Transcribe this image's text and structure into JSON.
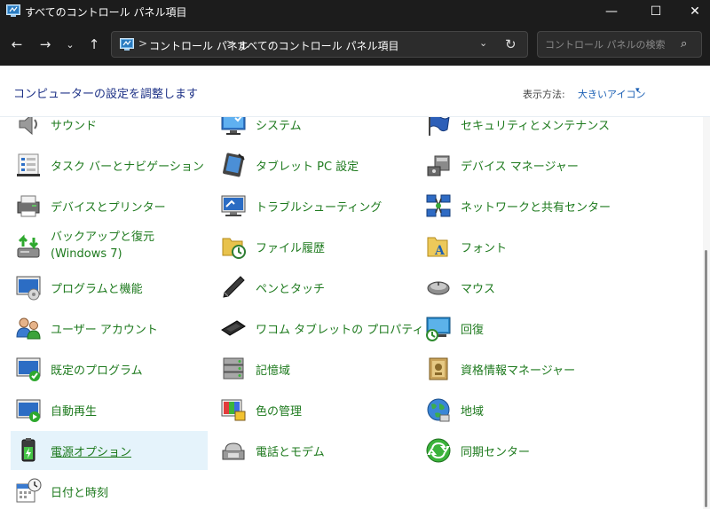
{
  "window": {
    "title": "すべてのコントロール パネル項目",
    "minimize_glyph": "—",
    "maximize_glyph": "☐",
    "close_glyph": "✕"
  },
  "nav": {
    "back_glyph": "←",
    "forward_glyph": "→",
    "recent_glyph": "⌄",
    "up_glyph": "↑",
    "breadcrumb": [
      "コントロール パネル",
      "すべてのコントロール パネル項目"
    ],
    "breadcrumb_separator": ">",
    "dropdown_glyph": "⌄",
    "refresh_glyph": "↻"
  },
  "search": {
    "placeholder": "コントロール パネルの検索",
    "value": "",
    "icon_glyph": "⌕"
  },
  "header": {
    "title": "コンピューターの設定を調整します",
    "view_label": "表示方法:",
    "view_value": "大きいアイコン",
    "view_caret": "▾"
  },
  "colors": {
    "titlebar_bg": "#1c1c1c",
    "item_label": "#1e7a1e",
    "header_title": "#1e3287",
    "link_accent": "#1a5fb4",
    "hover_bg": "#e5f3fb"
  },
  "items": [
    {
      "label": "サウンド",
      "icon": "speaker-icon"
    },
    {
      "label": "システム",
      "icon": "system-monitor-icon"
    },
    {
      "label": "セキュリティとメンテナンス",
      "icon": "security-flag-icon"
    },
    {
      "label": "タスク バーとナビゲーション",
      "icon": "taskbar-icon"
    },
    {
      "label": "タブレット PC 設定",
      "icon": "tablet-pc-icon"
    },
    {
      "label": "デバイス マネージャー",
      "icon": "device-manager-icon"
    },
    {
      "label": "デバイスとプリンター",
      "icon": "printer-icon"
    },
    {
      "label": "トラブルシューティング",
      "icon": "troubleshooting-icon"
    },
    {
      "label": "ネットワークと共有センター",
      "icon": "network-icon"
    },
    {
      "label": "バックアップと復元 (Windows 7)",
      "icon": "backup-restore-icon"
    },
    {
      "label": "ファイル履歴",
      "icon": "file-history-icon"
    },
    {
      "label": "フォント",
      "icon": "font-folder-icon"
    },
    {
      "label": "プログラムと機能",
      "icon": "programs-features-icon"
    },
    {
      "label": "ペンとタッチ",
      "icon": "pen-icon"
    },
    {
      "label": "マウス",
      "icon": "mouse-icon"
    },
    {
      "label": "ユーザー アカウント",
      "icon": "user-accounts-icon"
    },
    {
      "label": "ワコム タブレットの プロパティ",
      "icon": "wacom-tablet-icon"
    },
    {
      "label": "回復",
      "icon": "recovery-icon"
    },
    {
      "label": "既定のプログラム",
      "icon": "default-programs-icon"
    },
    {
      "label": "記憶域",
      "icon": "storage-spaces-icon"
    },
    {
      "label": "資格情報マネージャー",
      "icon": "credential-manager-icon"
    },
    {
      "label": "自動再生",
      "icon": "autoplay-icon"
    },
    {
      "label": "色の管理",
      "icon": "color-management-icon"
    },
    {
      "label": "地域",
      "icon": "region-globe-icon"
    },
    {
      "label": "電源オプション",
      "icon": "power-options-icon"
    },
    {
      "label": "電話とモデム",
      "icon": "phone-modem-icon"
    },
    {
      "label": "同期センター",
      "icon": "sync-center-icon"
    },
    {
      "label": "日付と時刻",
      "icon": "date-time-icon"
    }
  ]
}
